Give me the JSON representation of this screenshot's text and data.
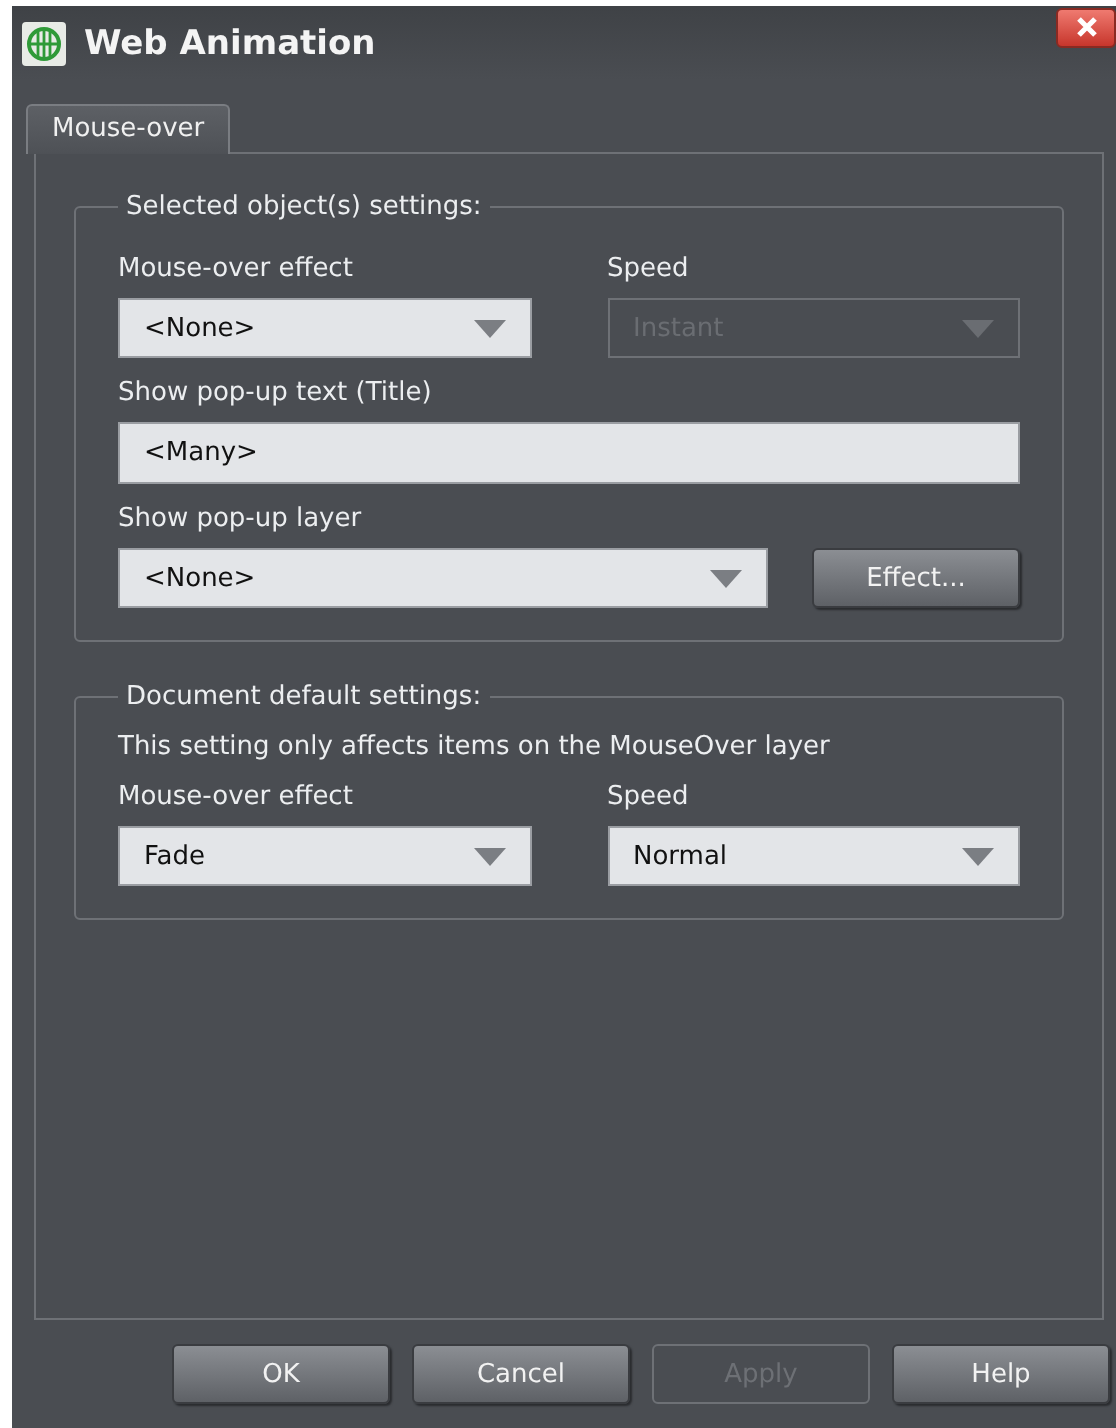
{
  "window": {
    "title": "Web Animation"
  },
  "tabs": [
    {
      "label": "Mouse-over",
      "selected": true
    }
  ],
  "selected_settings": {
    "title": "Selected object(s) settings:",
    "mouse_over_effect": {
      "label": "Mouse-over effect",
      "value": "<None>",
      "disabled": false
    },
    "speed": {
      "label": "Speed",
      "value": "Instant",
      "disabled": true
    },
    "popup_text": {
      "label": "Show pop-up text (Title)",
      "value": "<Many>"
    },
    "popup_layer": {
      "label": "Show pop-up layer",
      "value": "<None>",
      "disabled": false
    },
    "effect_button": {
      "label": "Effect..."
    }
  },
  "document_defaults": {
    "title": "Document default settings:",
    "note": "This setting only affects items on the MouseOver layer",
    "mouse_over_effect": {
      "label": "Mouse-over effect",
      "value": "Fade",
      "disabled": false
    },
    "speed": {
      "label": "Speed",
      "value": "Normal",
      "disabled": false
    }
  },
  "buttons": [
    {
      "label": "OK",
      "disabled": false
    },
    {
      "label": "Cancel",
      "disabled": false
    },
    {
      "label": "Apply",
      "disabled": true
    },
    {
      "label": "Help",
      "disabled": false
    }
  ]
}
